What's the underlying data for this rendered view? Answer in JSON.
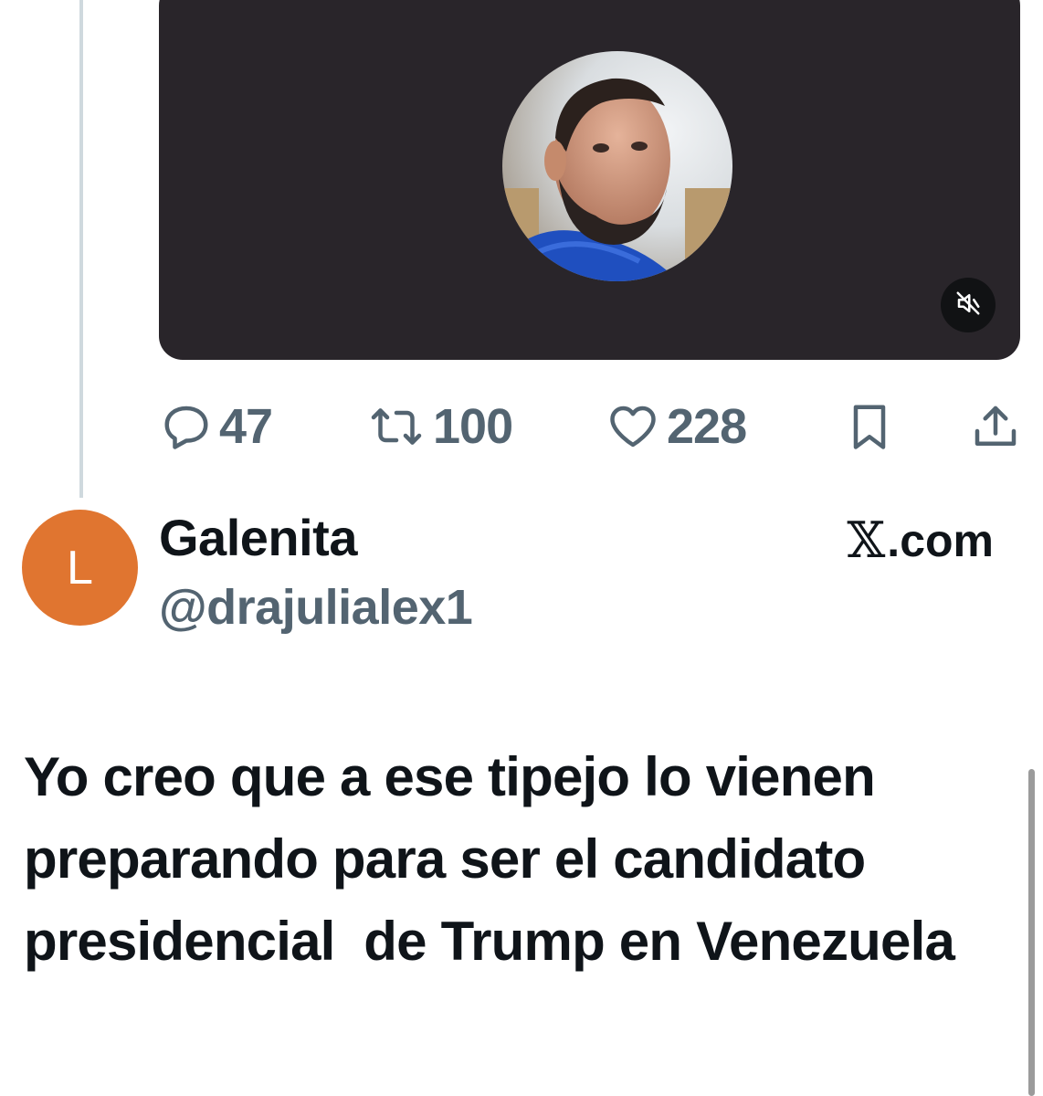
{
  "media": {
    "description_icon": "video-mute-icon",
    "background_color": "#29252a"
  },
  "actions": {
    "reply_count": "47",
    "repost_count": "100",
    "like_count": "228"
  },
  "reply": {
    "avatar_initial": "L",
    "avatar_color": "#e07530",
    "display_name": "Galenita",
    "handle": "@drajulialex1",
    "source_logo": "𝕏",
    "source_text": ".com",
    "text": "Yo creo que a ese tipejo lo vienen preparando para ser el candidato presidencial  de Trump en Venezuela"
  },
  "colors": {
    "text_primary": "#0f1419",
    "text_secondary": "#536471",
    "thread_line": "#cfd9de"
  }
}
